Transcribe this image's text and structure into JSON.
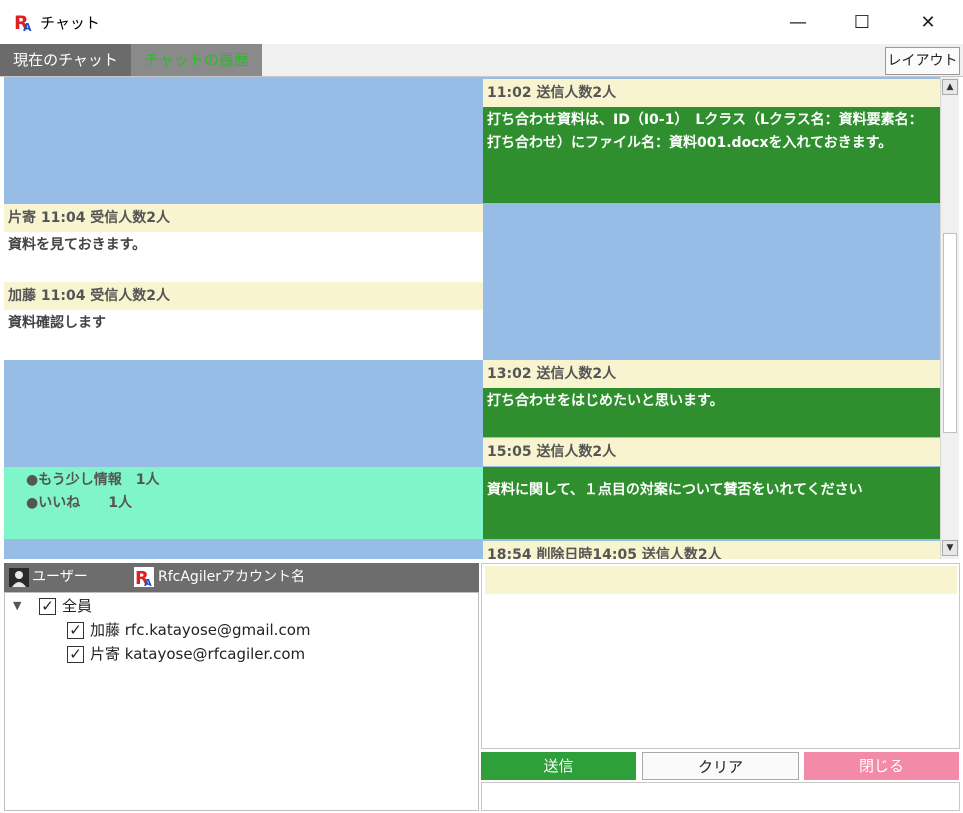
{
  "window": {
    "title": "チャット",
    "minimize": "—",
    "maximize": "☐",
    "close": "✕"
  },
  "tabs": [
    {
      "label": "現在のチャット"
    },
    {
      "label": "チャットの履歴"
    }
  ],
  "layout_button": "レイアウト",
  "messages": {
    "m1": {
      "header": "11:02 送信人数2人",
      "body": "打ち合わせ資料は、ID（I0-1）　Lクラス（Lクラス名：資料要素名：打ち合わせ）にファイル名：資料001.docxを入れておきます。"
    },
    "m2": {
      "header": "片寄 11:04 受信人数2人",
      "body": "資料を見ておきます。"
    },
    "m3": {
      "header": "加藤 11:04 受信人数2人",
      "body": "資料確認します"
    },
    "m4": {
      "header": "13:02 送信人数2人",
      "body": "打ち合わせをはじめたいと思います。"
    },
    "m5": {
      "header": "15:05 送信人数2人",
      "body": "資料に関して、１点目の対案について賛否をいれてください"
    },
    "m6": {
      "header": "18:54 削除日時14:05 送信人数2人"
    }
  },
  "reactions": [
    {
      "label": "●もう少し情報　1人"
    },
    {
      "label": "●いいね　　1人"
    }
  ],
  "users": {
    "header_user": "ユーザー",
    "header_account": "RfcAgilerアカウント名",
    "all": "全員",
    "list": [
      {
        "label": "加藤 rfc.katayose@gmail.com"
      },
      {
        "label": "片寄 katayose@rfcagiler.com"
      }
    ],
    "check": "✓",
    "expand": "▼"
  },
  "buttons": {
    "send": "送信",
    "clear": "クリア",
    "close": "閉じる"
  },
  "colors": {
    "sent_bg": "#2f8f2f",
    "header_bg": "#f8f4d0",
    "chat_bg": "#97bce6",
    "reaction_bg": "#7ff5c9",
    "send_button": "#2f9f3a",
    "close_button": "#f28aa8",
    "active_tab_text": "#22c022"
  }
}
